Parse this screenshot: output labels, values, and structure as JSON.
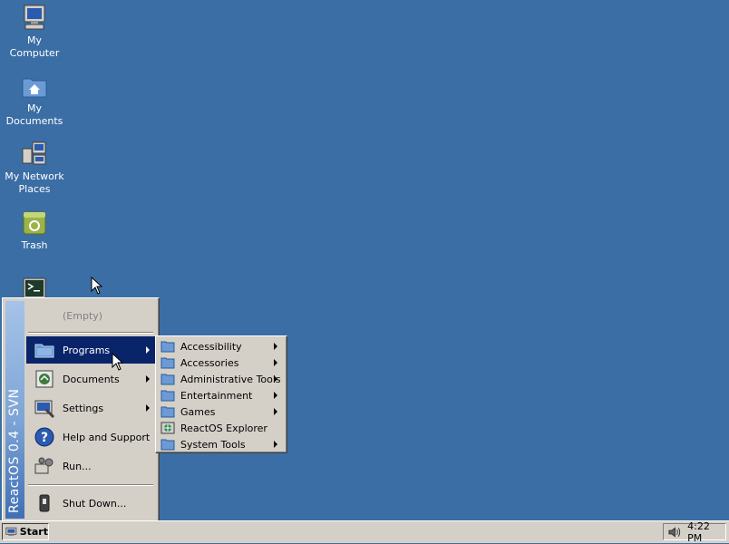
{
  "desktop": {
    "icons": [
      {
        "line1": "My",
        "line2": "Computer",
        "icon": "my-computer-icon"
      },
      {
        "line1": "My",
        "line2": "Documents",
        "icon": "my-documents-icon"
      },
      {
        "line1": "My Network",
        "line2": "Places",
        "icon": "network-places-icon"
      },
      {
        "line1": "Trash",
        "line2": "",
        "icon": "trash-icon"
      },
      {
        "line1": "",
        "line2": "",
        "icon": "command-prompt-icon"
      }
    ]
  },
  "start_menu": {
    "banner": "ReactOS  0.4 - SVN",
    "empty": "(Empty)",
    "items": {
      "programs": "Programs",
      "documents": "Documents",
      "settings": "Settings",
      "help": "Help and Support",
      "run": "Run...",
      "shutdown": "Shut Down..."
    }
  },
  "programs_submenu": {
    "items": [
      {
        "label": "Accessibility",
        "icon": "folder-icon",
        "has_submenu": true
      },
      {
        "label": "Accessories",
        "icon": "folder-icon",
        "has_submenu": true
      },
      {
        "label": "Administrative Tools",
        "icon": "folder-icon",
        "has_submenu": true
      },
      {
        "label": "Entertainment",
        "icon": "folder-icon",
        "has_submenu": true
      },
      {
        "label": "Games",
        "icon": "folder-icon",
        "has_submenu": true
      },
      {
        "label": "ReactOS Explorer",
        "icon": "explorer-icon",
        "has_submenu": false
      },
      {
        "label": "System Tools",
        "icon": "folder-icon",
        "has_submenu": true
      }
    ]
  },
  "taskbar": {
    "start_label": "Start",
    "clock": "4:22 PM"
  },
  "colors": {
    "desktop": "#3a6ea5",
    "highlight": "#0a246a",
    "face": "#d4d0c8"
  }
}
